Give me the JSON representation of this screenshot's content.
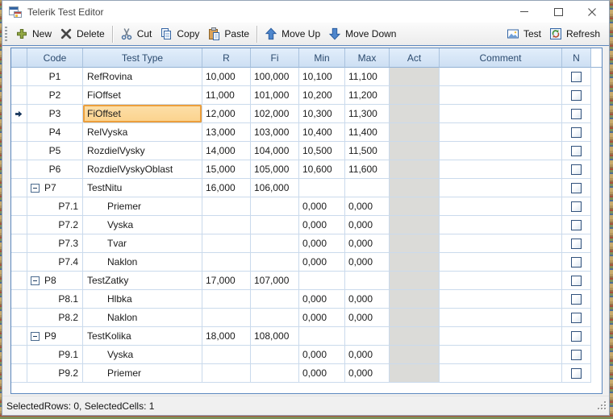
{
  "window": {
    "title": "Telerik Test Editor"
  },
  "toolbar": {
    "left": [
      {
        "id": "new",
        "label": "New",
        "icon": "plus-icon"
      },
      {
        "id": "delete",
        "label": "Delete",
        "icon": "delete-x-icon"
      },
      {
        "sep": true
      },
      {
        "id": "cut",
        "label": "Cut",
        "icon": "scissors-icon"
      },
      {
        "id": "copy",
        "label": "Copy",
        "icon": "copy-icon"
      },
      {
        "id": "paste",
        "label": "Paste",
        "icon": "paste-icon"
      },
      {
        "sep": true
      },
      {
        "id": "move-up",
        "label": "Move Up",
        "icon": "arrow-up-icon"
      },
      {
        "id": "move-down",
        "label": "Move Down",
        "icon": "arrow-down-icon"
      }
    ],
    "right": [
      {
        "id": "test",
        "label": "Test",
        "icon": "picture-icon"
      },
      {
        "id": "refresh",
        "label": "Refresh",
        "icon": "refresh-icon"
      }
    ]
  },
  "grid": {
    "columns": [
      "",
      "Code",
      "Test Type",
      "R",
      "Fi",
      "Min",
      "Max",
      "Act",
      "Comment",
      "N"
    ],
    "rows": [
      {
        "code": "P1",
        "test_type": "RefRovina",
        "r": "10,000",
        "fi": "100,000",
        "min": "10,100",
        "max": "11,100",
        "comment": "",
        "level": 0,
        "group": false,
        "current": false,
        "selected": false,
        "checked": false
      },
      {
        "code": "P2",
        "test_type": "FiOffset",
        "r": "11,000",
        "fi": "101,000",
        "min": "10,200",
        "max": "11,200",
        "comment": "",
        "level": 0,
        "group": false,
        "current": false,
        "selected": false,
        "checked": false
      },
      {
        "code": "P3",
        "test_type": "FiOffset",
        "r": "12,000",
        "fi": "102,000",
        "min": "10,300",
        "max": "11,300",
        "comment": "",
        "level": 0,
        "group": false,
        "current": true,
        "selected": true,
        "checked": false
      },
      {
        "code": "P4",
        "test_type": "RelVyska",
        "r": "13,000",
        "fi": "103,000",
        "min": "10,400",
        "max": "11,400",
        "comment": "",
        "level": 0,
        "group": false,
        "current": false,
        "selected": false,
        "checked": false
      },
      {
        "code": "P5",
        "test_type": "RozdielVysky",
        "r": "14,000",
        "fi": "104,000",
        "min": "10,500",
        "max": "11,500",
        "comment": "",
        "level": 0,
        "group": false,
        "current": false,
        "selected": false,
        "checked": false
      },
      {
        "code": "P6",
        "test_type": "RozdielVyskyOblast",
        "r": "15,000",
        "fi": "105,000",
        "min": "10,600",
        "max": "11,600",
        "comment": "",
        "level": 0,
        "group": false,
        "current": false,
        "selected": false,
        "checked": false
      },
      {
        "code": "P7",
        "test_type": "TestNitu",
        "r": "16,000",
        "fi": "106,000",
        "min": "",
        "max": "",
        "comment": "",
        "level": 0,
        "group": true,
        "current": false,
        "selected": false,
        "checked": false
      },
      {
        "code": "P7.1",
        "test_type": "Priemer",
        "r": "",
        "fi": "",
        "min": "0,000",
        "max": "0,000",
        "comment": "",
        "level": 1,
        "group": false,
        "current": false,
        "selected": false,
        "checked": false
      },
      {
        "code": "P7.2",
        "test_type": "Vyska",
        "r": "",
        "fi": "",
        "min": "0,000",
        "max": "0,000",
        "comment": "",
        "level": 1,
        "group": false,
        "current": false,
        "selected": false,
        "checked": false
      },
      {
        "code": "P7.3",
        "test_type": "Tvar",
        "r": "",
        "fi": "",
        "min": "0,000",
        "max": "0,000",
        "comment": "",
        "level": 1,
        "group": false,
        "current": false,
        "selected": false,
        "checked": false
      },
      {
        "code": "P7.4",
        "test_type": "Naklon",
        "r": "",
        "fi": "",
        "min": "0,000",
        "max": "0,000",
        "comment": "",
        "level": 1,
        "group": false,
        "current": false,
        "selected": false,
        "checked": false
      },
      {
        "code": "P8",
        "test_type": "TestZatky",
        "r": "17,000",
        "fi": "107,000",
        "min": "",
        "max": "",
        "comment": "",
        "level": 0,
        "group": true,
        "current": false,
        "selected": false,
        "checked": false
      },
      {
        "code": "P8.1",
        "test_type": "Hlbka",
        "r": "",
        "fi": "",
        "min": "0,000",
        "max": "0,000",
        "comment": "",
        "level": 1,
        "group": false,
        "current": false,
        "selected": false,
        "checked": false
      },
      {
        "code": "P8.2",
        "test_type": "Naklon",
        "r": "",
        "fi": "",
        "min": "0,000",
        "max": "0,000",
        "comment": "",
        "level": 1,
        "group": false,
        "current": false,
        "selected": false,
        "checked": false
      },
      {
        "code": "P9",
        "test_type": "TestKolika",
        "r": "18,000",
        "fi": "108,000",
        "min": "",
        "max": "",
        "comment": "",
        "level": 0,
        "group": true,
        "current": false,
        "selected": false,
        "checked": false
      },
      {
        "code": "P9.1",
        "test_type": "Vyska",
        "r": "",
        "fi": "",
        "min": "0,000",
        "max": "0,000",
        "comment": "",
        "level": 1,
        "group": false,
        "current": false,
        "selected": false,
        "checked": false
      },
      {
        "code": "P9.2",
        "test_type": "Priemer",
        "r": "",
        "fi": "",
        "min": "0,000",
        "max": "0,000",
        "comment": "",
        "level": 1,
        "group": false,
        "current": false,
        "selected": false,
        "checked": false
      }
    ]
  },
  "status_bar": {
    "text": "SelectedRows: 0, SelectedCells: 1"
  },
  "colors": {
    "selection_fill": "#FBD28C",
    "selection_border": "#EC9F3C",
    "grid_border": "#5B87BE",
    "header_bg_top": "#E2EEFB",
    "header_bg_bottom": "#CDDFF3",
    "header_text": "#2B4A6E",
    "gridline": "#CADAEC",
    "act_cell_fill": "#DBDBD8",
    "window_bg": "#F0F0F0"
  }
}
